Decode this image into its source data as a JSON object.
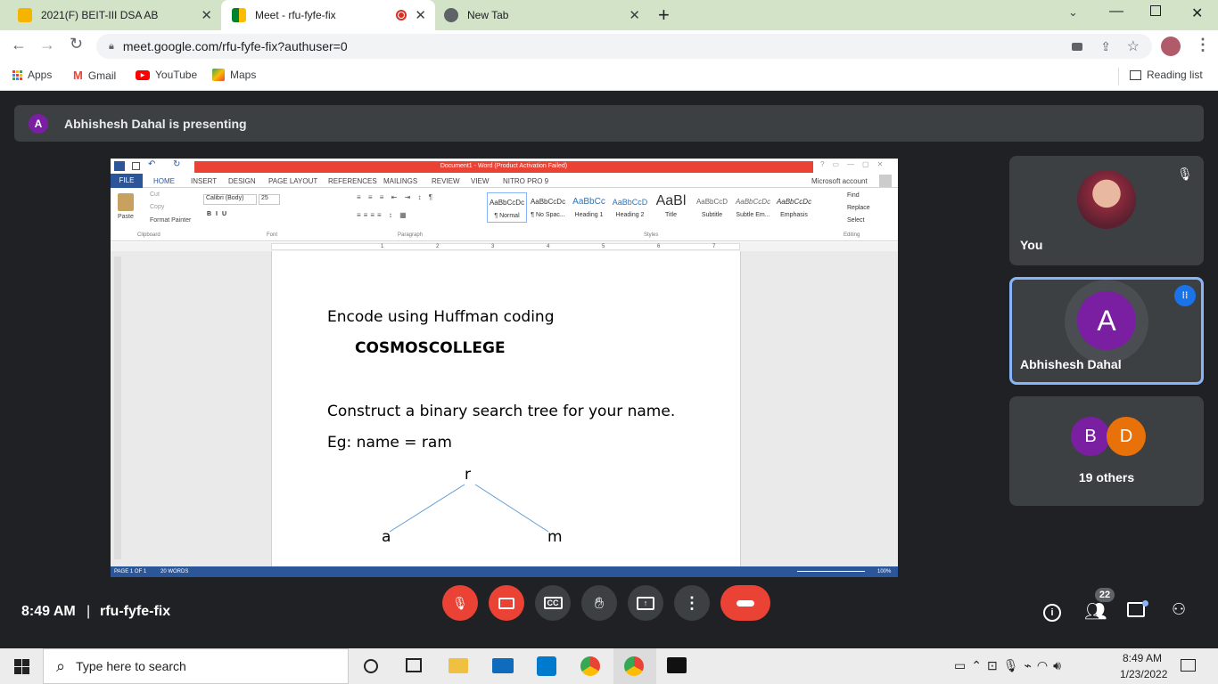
{
  "browser": {
    "tabs": [
      {
        "title": "2021(F) BEIT-III DSA AB"
      },
      {
        "title": "Meet - rfu-fyfe-fix"
      },
      {
        "title": "New Tab"
      }
    ],
    "url": "meet.google.com/rfu-fyfe-fix?authuser=0",
    "bookmarks": [
      "Apps",
      "Gmail",
      "YouTube",
      "Maps"
    ],
    "reading_list": "Reading list"
  },
  "meet": {
    "presenting_initial": "A",
    "presenting_text": "Abhishesh Dahal is presenting",
    "tiles": {
      "you_label": "You",
      "speaker_initial": "A",
      "speaker_name": "Abhishesh Dahal",
      "others_initials": [
        "B",
        "D"
      ],
      "others_label": "19 others"
    },
    "time": "8:49 AM",
    "separator": "|",
    "meeting_code": "rfu-fyfe-fix",
    "participant_count": "22"
  },
  "word": {
    "title": "Document1 - Word (Product Activation Failed)",
    "tabs": [
      "FILE",
      "HOME",
      "INSERT",
      "DESIGN",
      "PAGE LAYOUT",
      "REFERENCES",
      "MAILINGS",
      "REVIEW",
      "VIEW",
      "NITRO PRO 9"
    ],
    "account": "Microsoft account",
    "clipboard": {
      "cut": "Cut",
      "copy": "Copy",
      "paste": "Paste",
      "format_painter": "Format Painter",
      "group": "Clipboard"
    },
    "font": {
      "name": "Calibri (Body)",
      "size": "25",
      "group": "Font"
    },
    "paragraph_group": "Paragraph",
    "styles": [
      {
        "preview": "AaBbCcDc",
        "name": "¶ Normal"
      },
      {
        "preview": "AaBbCcDc",
        "name": "¶ No Spac..."
      },
      {
        "preview": "AaBbCc",
        "name": "Heading 1"
      },
      {
        "preview": "AaBbCcD",
        "name": "Heading 2"
      },
      {
        "preview": "AaBl",
        "name": "Title"
      },
      {
        "preview": "AaBbCcD",
        "name": "Subtitle"
      },
      {
        "preview": "AaBbCcDc",
        "name": "Subtle Em..."
      },
      {
        "preview": "AaBbCcDc",
        "name": "Emphasis"
      }
    ],
    "styles_group": "Styles",
    "editing": {
      "find": "Find",
      "replace": "Replace",
      "select": "Select",
      "group": "Editing"
    },
    "ruler_numbers": [
      "1",
      "1",
      "2",
      "3",
      "4",
      "5",
      "6",
      "7"
    ],
    "doc": {
      "line1": "Encode using Huffman coding",
      "line2": "COSMOSCOLLEGE",
      "line3": "Construct a binary search tree for your name.",
      "line4": "Eg: name = ram",
      "tree_root": "r",
      "tree_left": "a",
      "tree_right": "m"
    },
    "status": {
      "page": "PAGE 1 OF 1",
      "words": "20 WORDS",
      "zoom": "100%"
    }
  },
  "taskbar": {
    "search_placeholder": "Type here to search",
    "time": "8:49 AM",
    "date": "1/23/2022"
  },
  "colors": {
    "accent_red": "#ea4335",
    "word_blue": "#2b579a",
    "meet_bg": "#202124",
    "tile_bg": "#3c4043",
    "purple": "#7b1fa2",
    "orange": "#e8710a",
    "speaking_blue": "#8ab4f8"
  }
}
